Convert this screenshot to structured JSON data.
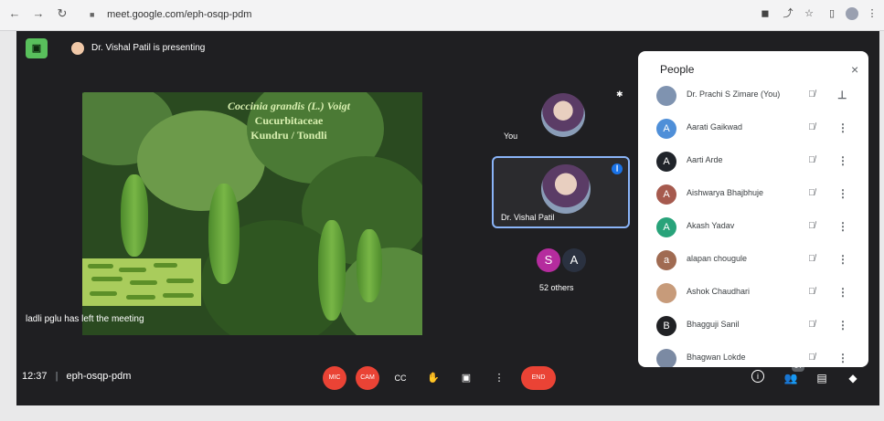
{
  "browser": {
    "url": "meet.google.com/eph-osqp-pdm",
    "back_icon": "arrow-left-icon",
    "forward_icon": "arrow-right-icon",
    "reload_icon": "reload-icon"
  },
  "meeting": {
    "presenting_text": "Dr. Vishal Patil is presenting",
    "time": "12:37",
    "separator": "|",
    "code": "eph-osqp-pdm",
    "toast": "ladli pglu has left the meeting"
  },
  "slide": {
    "line1": "Coccinia grandis (L.) Voigt",
    "line2": "Cucurbitaceae",
    "line3": "Kundru / Tondli"
  },
  "tiles": {
    "you_label": "You",
    "presenter_label": "Dr. Vishal Patil",
    "others_count": "52 others",
    "others_initials": [
      "S",
      "A"
    ]
  },
  "controls": {
    "mic": "MIC",
    "camera": "CAM",
    "captions": "CC",
    "raise_hand": "✋",
    "present": "▣",
    "more": "⋮",
    "end_call": "END"
  },
  "right_controls": {
    "info": "i",
    "people": "👥",
    "people_badge": "54",
    "chat": "▤",
    "activities": "◆"
  },
  "people_panel": {
    "title": "People",
    "close": "×",
    "participants": [
      {
        "name": "Dr. Prachi S Zimare (You)",
        "initial": "",
        "color": "#7f93b0"
      },
      {
        "name": "Aarati Gaikwad",
        "initial": "A",
        "color": "#4f8fd8"
      },
      {
        "name": "Aarti Arde",
        "initial": "A",
        "color": "#20242a"
      },
      {
        "name": "Aishwarya Bhajbhuje",
        "initial": "A",
        "color": "#a65a4e"
      },
      {
        "name": "Akash Yadav",
        "initial": "A",
        "color": "#28a37a"
      },
      {
        "name": "alapan chougule",
        "initial": "a",
        "color": "#a06b52"
      },
      {
        "name": "Ashok Chaudhari",
        "initial": "",
        "color": "#c79b7a"
      },
      {
        "name": "Bhagguji Sanil",
        "initial": "B",
        "color": "#202124"
      },
      {
        "name": "Bhagwan Lokde",
        "initial": "",
        "color": "#7b8aa3"
      }
    ]
  },
  "colors": {
    "meet_background": "#1f1f22",
    "accent_blue": "#8ab4f8",
    "danger_red": "#ea4335"
  }
}
